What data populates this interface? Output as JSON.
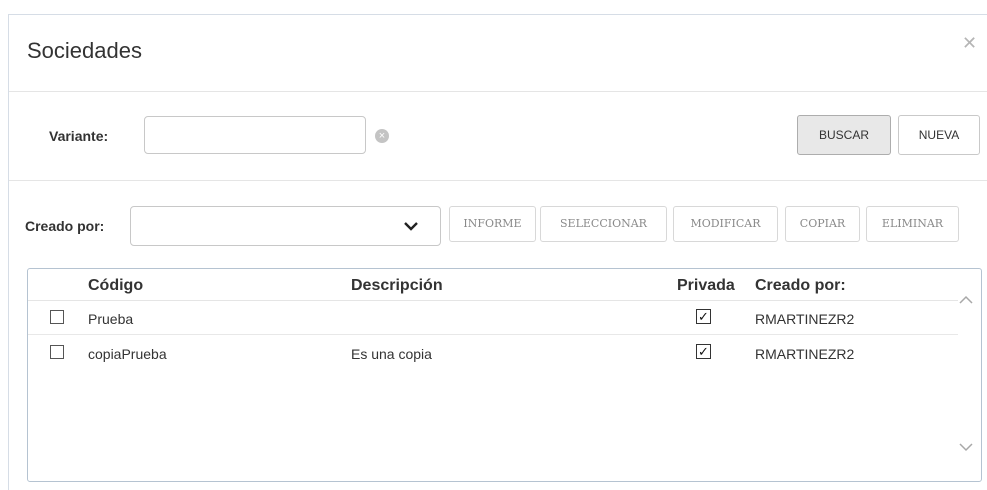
{
  "dialog": {
    "title": "Sociedades",
    "close_icon": "close-icon"
  },
  "variante": {
    "label": "Variante:",
    "value": "",
    "placeholder": "",
    "clear_icon": "clear-circle-icon"
  },
  "buttons": {
    "buscar": "BUSCAR",
    "nueva": "NUEVA"
  },
  "creado_por": {
    "label": "Creado por:",
    "selected": ""
  },
  "actions": {
    "informe": "INFORME",
    "seleccionar": "SELECCIONAR",
    "modificar": "MODIFICAR",
    "copiar": "COPIAR",
    "eliminar": "ELIMINAR"
  },
  "table": {
    "columns": {
      "codigo": "Código",
      "descripcion": "Descripción",
      "privada": "Privada",
      "creado_por": "Creado por:"
    },
    "rows": [
      {
        "selected": false,
        "codigo": "Prueba",
        "descripcion": "",
        "privada": true,
        "creado_por": "RMARTINEZR2"
      },
      {
        "selected": false,
        "codigo": "copiaPrueba",
        "descripcion": "Es una copia",
        "privada": true,
        "creado_por": "RMARTINEZR2"
      }
    ],
    "check_mark": "✓"
  },
  "colors": {
    "border": "#b5c3d1",
    "button_disabled_text": "#8a8a8a",
    "active_button_bg": "#e8e8e8"
  }
}
